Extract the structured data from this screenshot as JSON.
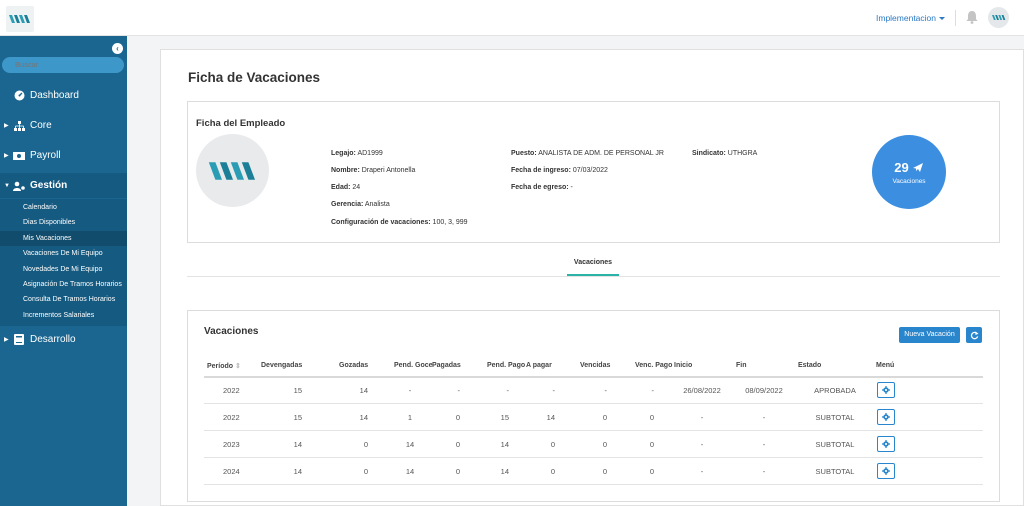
{
  "header": {
    "environment_label": "Implementacion",
    "icons": [
      "logo",
      "caret-down-icon",
      "bell-icon",
      "user-avatar"
    ]
  },
  "sidebar": {
    "search_placeholder": "Buscar",
    "items": [
      {
        "label": "Dashboard",
        "icon": "dashboard-icon"
      },
      {
        "label": "Core",
        "icon": "sitemap-icon"
      },
      {
        "label": "Payroll",
        "icon": "money-icon"
      },
      {
        "label": "Gestión",
        "icon": "users-cog-icon"
      },
      {
        "label": "Desarrollo",
        "icon": "book-icon"
      }
    ],
    "submenu": [
      "Calendario",
      "Dias Disponibles",
      "Mis Vacaciones",
      "Vacaciones De Mi Equipo",
      "Novedades De Mi Equipo",
      "Asignación De Tramos Horarios",
      "Consulta De Tramos Horarios",
      "Incrementos Salariales"
    ],
    "active_submenu": "Mis Vacaciones"
  },
  "page": {
    "title": "Ficha de Vacaciones"
  },
  "employee": {
    "card_title": "Ficha del Empleado",
    "fields": {
      "legajo": {
        "label": "Legajo:",
        "value": "AD1999"
      },
      "nombre": {
        "label": "Nombre:",
        "value": "Draperi Antonella"
      },
      "edad": {
        "label": "Edad:",
        "value": "24"
      },
      "gerencia": {
        "label": "Gerencia:",
        "value": "Analista"
      },
      "config": {
        "label": "Configuración de vacaciones:",
        "value": "100, 3, 999"
      },
      "puesto": {
        "label": "Puesto:",
        "value": "ANALISTA DE ADM. DE PERSONAL JR"
      },
      "ingreso": {
        "label": "Fecha de ingreso:",
        "value": "07/03/2022"
      },
      "egreso": {
        "label": "Fecha de egreso:",
        "value": "-"
      },
      "sindicato": {
        "label": "Sindicato:",
        "value": "UTHGRA"
      }
    },
    "vacation_days": "29",
    "vacation_days_label": "Vacaciones"
  },
  "tabs": [
    {
      "label": "Vacaciones",
      "active": true
    }
  ],
  "vacations": {
    "title": "Vacaciones",
    "new_button": "Nueva Vacación",
    "columns": [
      "Período",
      "Devengadas",
      "Gozadas",
      "Pend. Goce",
      "Pagadas",
      "Pend. Pago",
      "A pagar",
      "Vencidas",
      "Venc. Pago",
      "Inicio",
      "Fin",
      "Estado",
      "Menú"
    ],
    "sort_indicator": "⇕",
    "rows": [
      [
        "2022",
        "15",
        "14",
        "-",
        "-",
        "-",
        "-",
        "-",
        "-",
        "26/08/2022",
        "08/09/2022",
        "APROBADA"
      ],
      [
        "2022",
        "15",
        "14",
        "1",
        "0",
        "15",
        "14",
        "0",
        "0",
        "-",
        "-",
        "SUBTOTAL"
      ],
      [
        "2023",
        "14",
        "0",
        "14",
        "0",
        "14",
        "0",
        "0",
        "0",
        "-",
        "-",
        "SUBTOTAL"
      ],
      [
        "2024",
        "14",
        "0",
        "14",
        "0",
        "14",
        "0",
        "0",
        "0",
        "-",
        "-",
        "SUBTOTAL"
      ]
    ]
  },
  "colors": {
    "sidebar": "#1a6690",
    "primary": "#2a86cc",
    "accent": "#2bb3a8",
    "badge": "#3b8ee0"
  }
}
